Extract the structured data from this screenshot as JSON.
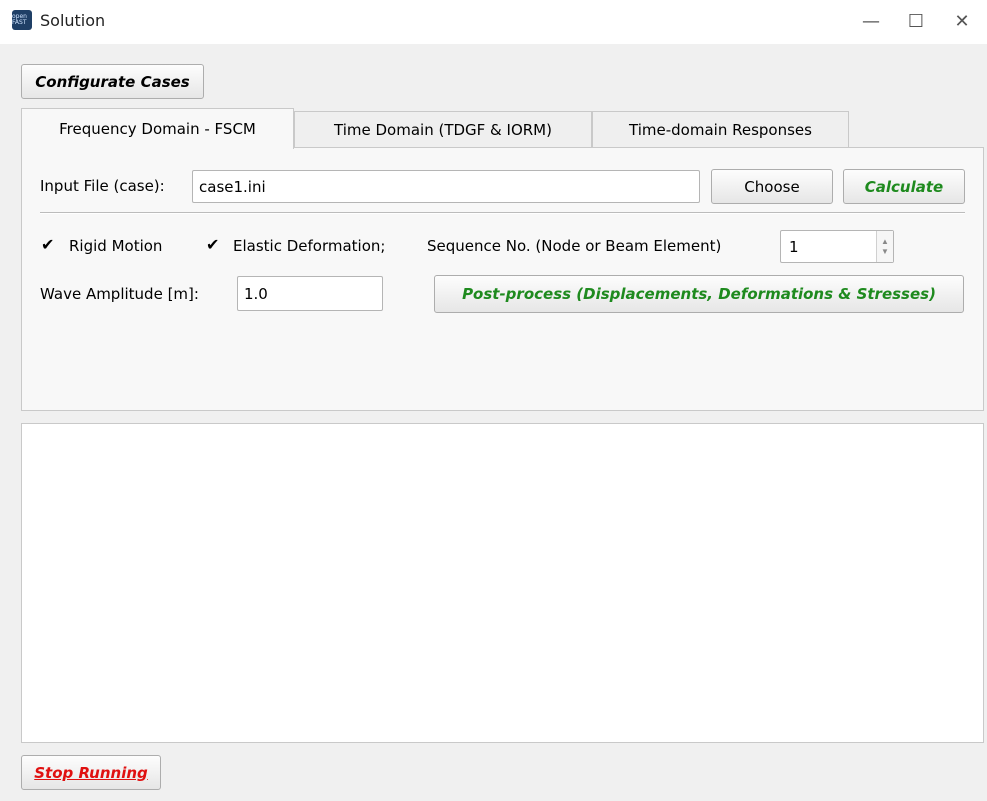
{
  "window": {
    "title": "Solution",
    "icon_text": "open FAST",
    "minimize_glyph": "—",
    "maximize_glyph": "☐",
    "close_glyph": "✕"
  },
  "toolbar": {
    "configurate_label": "Configurate Cases"
  },
  "tabs": [
    {
      "label": "Frequency Domain - FSCM",
      "active": true
    },
    {
      "label": "Time Domain (TDGF & IORM)",
      "active": false
    },
    {
      "label": "Time-domain Responses",
      "active": false
    }
  ],
  "panel": {
    "input_file_label": "Input File (case):",
    "input_file_value": "case1.ini",
    "choose_label": "Choose",
    "calculate_label": "Calculate",
    "rigid_motion": {
      "label": "Rigid Motion",
      "checked": true
    },
    "elastic_deformation": {
      "label": "Elastic Deformation;",
      "checked": true
    },
    "sequence_label": "Sequence No. (Node or Beam Element)",
    "sequence_value": "1",
    "wave_amplitude_label": "Wave Amplitude [m]:",
    "wave_amplitude_value": "1.0",
    "postprocess_label": "Post-process (Displacements, Deformations & Stresses)",
    "check_glyph": "✔"
  },
  "output": {
    "text": ""
  },
  "footer": {
    "stop_label": "Stop Running"
  },
  "colors": {
    "green_text": "#1e8a1e",
    "red_text": "#e01010"
  }
}
